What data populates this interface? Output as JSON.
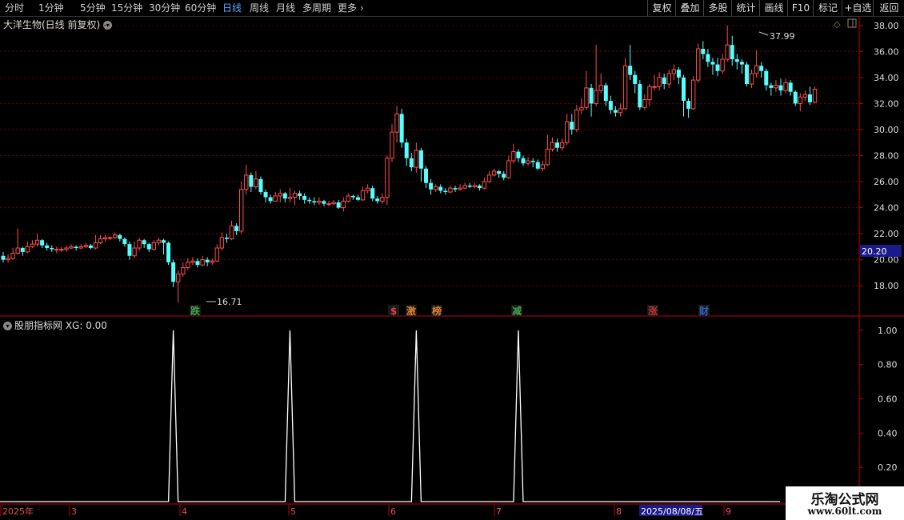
{
  "toolbar": {
    "periods": [
      "分时",
      "1分钟",
      "5分钟",
      "15分钟",
      "30分钟",
      "60分钟",
      "日线",
      "周线",
      "月线",
      "多周期",
      "更多"
    ],
    "active_period": "日线",
    "right_buttons": [
      "复权",
      "叠加",
      "多股",
      "统计",
      "画线",
      "F10",
      "标记",
      "+自选",
      "返回"
    ]
  },
  "main_title": "大洋生物(日线 前复权)",
  "indicator_title": "股朋指标网 XG: 0.00",
  "price_axis": {
    "ticks": [
      "38.00",
      "36.00",
      "34.00",
      "32.00",
      "30.00",
      "28.00",
      "26.00",
      "24.00",
      "22.00",
      "20.00",
      "18.00"
    ],
    "current_price": "20.20"
  },
  "indicator_axis": {
    "ticks": [
      "1.00",
      "0.80",
      "0.60",
      "0.40",
      "0.20"
    ]
  },
  "annotations": {
    "high": "37.99",
    "low": "16.71"
  },
  "event_markers": [
    {
      "label": "跌",
      "color": "#3fa34d"
    },
    {
      "label": "$",
      "color": "#e04040"
    },
    {
      "label": "激",
      "color": "#e08030"
    },
    {
      "label": "榜",
      "color": "#e08030"
    },
    {
      "label": "减",
      "color": "#3fa34d"
    },
    {
      "label": "涨",
      "color": "#c03030"
    },
    {
      "label": "财",
      "color": "#3060c0"
    }
  ],
  "time_axis": {
    "labels": [
      "2025年",
      "3",
      "4",
      "5",
      "6",
      "7",
      "8",
      "9"
    ],
    "cursor_date": "2025/08/08/五"
  },
  "watermark": {
    "line1": "乐淘公式网",
    "line2": "www.60lt.com"
  },
  "colors": {
    "up": "#ff4c4c",
    "down": "#54ffff",
    "grid": "#7a0000",
    "axis": "#c00000"
  },
  "chart_data": {
    "type": "candlestick",
    "ylim": [
      15.8,
      38.6
    ],
    "candles": [
      [
        20.3,
        20.0,
        20.6,
        19.8
      ],
      [
        20.0,
        20.1,
        20.4,
        19.8
      ],
      [
        20.1,
        20.5,
        20.9,
        20.0
      ],
      [
        20.5,
        20.9,
        22.4,
        20.4
      ],
      [
        20.9,
        20.6,
        21.0,
        20.3
      ],
      [
        20.6,
        21.0,
        21.4,
        20.5
      ],
      [
        21.0,
        21.2,
        21.5,
        20.9
      ],
      [
        21.2,
        21.5,
        22.0,
        21.0
      ],
      [
        21.5,
        21.1,
        21.6,
        20.9
      ],
      [
        21.1,
        20.9,
        21.3,
        20.7
      ],
      [
        20.9,
        20.8,
        21.1,
        20.6
      ],
      [
        20.8,
        20.8,
        21.0,
        20.5
      ],
      [
        20.8,
        20.8,
        21.0,
        20.6
      ],
      [
        20.8,
        20.9,
        21.1,
        20.6
      ],
      [
        20.9,
        21.0,
        21.2,
        20.8
      ],
      [
        21.0,
        20.9,
        21.1,
        20.7
      ],
      [
        20.9,
        21.0,
        21.2,
        20.8
      ],
      [
        21.0,
        21.1,
        21.3,
        20.9
      ],
      [
        21.1,
        20.9,
        21.2,
        20.8
      ],
      [
        20.9,
        21.3,
        21.9,
        20.8
      ],
      [
        21.3,
        21.6,
        21.9,
        21.2
      ],
      [
        21.6,
        21.7,
        21.9,
        21.4
      ],
      [
        21.7,
        21.7,
        21.8,
        21.5
      ],
      [
        21.7,
        21.9,
        22.1,
        21.6
      ],
      [
        21.9,
        21.6,
        22.0,
        21.4
      ],
      [
        21.6,
        21.2,
        21.7,
        21.0
      ],
      [
        21.2,
        20.3,
        21.4,
        20.0
      ],
      [
        20.3,
        20.9,
        21.4,
        20.1
      ],
      [
        20.9,
        21.5,
        21.7,
        20.7
      ],
      [
        21.5,
        21.2,
        21.6,
        20.9
      ],
      [
        21.2,
        20.8,
        21.3,
        20.6
      ],
      [
        20.8,
        21.3,
        21.5,
        20.7
      ],
      [
        21.3,
        21.5,
        21.7,
        21.1
      ],
      [
        21.5,
        21.3,
        21.6,
        20.4
      ],
      [
        21.3,
        19.8,
        21.4,
        19.6
      ],
      [
        19.8,
        18.3,
        20.0,
        17.9
      ],
      [
        18.3,
        18.9,
        19.2,
        16.7
      ],
      [
        18.9,
        19.4,
        19.8,
        18.7
      ],
      [
        19.4,
        19.8,
        20.1,
        19.2
      ],
      [
        19.8,
        19.9,
        20.2,
        19.6
      ],
      [
        19.9,
        19.6,
        20.1,
        19.4
      ],
      [
        19.6,
        20.0,
        20.3,
        19.5
      ],
      [
        20.0,
        19.8,
        20.2,
        19.5
      ],
      [
        19.8,
        19.9,
        20.1,
        19.6
      ],
      [
        19.9,
        20.9,
        21.2,
        19.8
      ],
      [
        20.9,
        21.7,
        22.1,
        20.7
      ],
      [
        21.7,
        21.6,
        22.0,
        21.3
      ],
      [
        21.6,
        22.6,
        23.0,
        21.5
      ],
      [
        22.6,
        22.2,
        22.8,
        21.9
      ],
      [
        22.2,
        25.4,
        26.0,
        22.0
      ],
      [
        25.4,
        26.5,
        27.3,
        25.0
      ],
      [
        26.5,
        25.6,
        26.7,
        25.2
      ],
      [
        25.6,
        26.2,
        26.8,
        25.4
      ],
      [
        26.2,
        25.2,
        26.4,
        25.0
      ],
      [
        25.2,
        24.8,
        25.4,
        24.4
      ],
      [
        24.8,
        24.5,
        25.0,
        24.3
      ],
      [
        24.5,
        24.9,
        25.2,
        24.6
      ],
      [
        24.9,
        25.1,
        25.4,
        24.4
      ],
      [
        25.1,
        24.7,
        25.2,
        24.4
      ],
      [
        24.7,
        24.8,
        25.5,
        24.4
      ],
      [
        24.8,
        25.1,
        25.3,
        24.2
      ],
      [
        25.1,
        24.9,
        25.3,
        24.6
      ],
      [
        24.9,
        24.6,
        25.1,
        24.3
      ],
      [
        24.6,
        24.5,
        24.8,
        24.3
      ],
      [
        24.5,
        24.4,
        24.8,
        24.2
      ],
      [
        24.4,
        24.5,
        24.8,
        24.2
      ],
      [
        24.5,
        24.3,
        24.6,
        24.1
      ],
      [
        24.3,
        24.3,
        24.5,
        24.1
      ],
      [
        24.3,
        24.4,
        24.6,
        24.2
      ],
      [
        24.4,
        24.0,
        24.6,
        23.9
      ],
      [
        24.0,
        24.5,
        24.8,
        23.7
      ],
      [
        24.5,
        24.9,
        25.1,
        24.4
      ],
      [
        24.9,
        24.8,
        25.0,
        24.6
      ],
      [
        24.8,
        24.6,
        25.0,
        24.5
      ],
      [
        24.6,
        25.3,
        25.6,
        24.5
      ],
      [
        25.3,
        25.5,
        25.8,
        25.1
      ],
      [
        25.5,
        24.7,
        25.7,
        24.5
      ],
      [
        24.7,
        24.5,
        24.9,
        24.3
      ],
      [
        24.5,
        24.8,
        25.1,
        24.3
      ],
      [
        24.8,
        27.8,
        28.0,
        24.2
      ],
      [
        27.8,
        29.8,
        30.4,
        27.5
      ],
      [
        29.8,
        31.2,
        31.8,
        29.0
      ],
      [
        31.2,
        29.0,
        31.6,
        28.6
      ],
      [
        29.0,
        27.8,
        29.3,
        27.2
      ],
      [
        27.8,
        27.1,
        28.2,
        26.8
      ],
      [
        27.1,
        28.4,
        29.0,
        26.7
      ],
      [
        28.4,
        27.0,
        28.6,
        26.0
      ],
      [
        27.0,
        25.9,
        27.2,
        25.5
      ],
      [
        25.9,
        25.4,
        26.2,
        25.0
      ],
      [
        25.4,
        25.6,
        25.8,
        25.2
      ],
      [
        25.6,
        25.3,
        25.8,
        25.1
      ],
      [
        25.3,
        25.2,
        25.5,
        25.0
      ],
      [
        25.2,
        25.5,
        25.7,
        25.1
      ],
      [
        25.5,
        25.4,
        25.7,
        25.2
      ],
      [
        25.4,
        25.5,
        25.8,
        25.3
      ],
      [
        25.5,
        25.7,
        25.9,
        25.4
      ],
      [
        25.7,
        25.6,
        25.9,
        25.5
      ],
      [
        25.6,
        25.7,
        25.9,
        25.5
      ],
      [
        25.7,
        25.5,
        25.8,
        25.3
      ],
      [
        25.5,
        26.0,
        26.3,
        25.4
      ],
      [
        26.0,
        26.5,
        26.8,
        25.9
      ],
      [
        26.5,
        26.8,
        27.0,
        26.4
      ],
      [
        26.8,
        26.6,
        26.9,
        26.3
      ],
      [
        26.6,
        26.3,
        26.8,
        26.1
      ],
      [
        26.3,
        27.6,
        28.0,
        26.2
      ],
      [
        27.6,
        28.3,
        28.9,
        27.4
      ],
      [
        28.3,
        27.8,
        28.5,
        27.5
      ],
      [
        27.8,
        27.4,
        28.0,
        27.2
      ],
      [
        27.4,
        27.6,
        27.9,
        27.2
      ],
      [
        27.6,
        27.5,
        27.8,
        27.1
      ],
      [
        27.5,
        27.0,
        27.7,
        26.9
      ],
      [
        27.0,
        27.3,
        27.6,
        26.8
      ],
      [
        27.3,
        28.5,
        29.6,
        27.2
      ],
      [
        28.5,
        29.0,
        29.4,
        28.3
      ],
      [
        29.0,
        28.6,
        29.3,
        28.3
      ],
      [
        28.6,
        29.0,
        29.3,
        28.4
      ],
      [
        29.0,
        30.6,
        31.2,
        28.8
      ],
      [
        30.6,
        30.0,
        31.2,
        29.6
      ],
      [
        30.0,
        31.5,
        31.9,
        29.8
      ],
      [
        31.5,
        31.7,
        32.4,
        31.2
      ],
      [
        31.7,
        33.2,
        34.5,
        31.5
      ],
      [
        33.2,
        32.0,
        33.5,
        31.0
      ],
      [
        32.0,
        33.0,
        36.5,
        31.8
      ],
      [
        33.0,
        33.4,
        34.3,
        32.8
      ],
      [
        33.4,
        32.2,
        33.6,
        31.8
      ],
      [
        32.2,
        31.5,
        32.6,
        31.2
      ],
      [
        31.5,
        31.3,
        31.8,
        31.0
      ],
      [
        31.3,
        31.6,
        32.0,
        31.0
      ],
      [
        31.6,
        34.9,
        35.5,
        31.5
      ],
      [
        34.9,
        34.2,
        36.5,
        33.8
      ],
      [
        34.2,
        33.5,
        34.5,
        32.8
      ],
      [
        33.5,
        31.7,
        33.8,
        31.5
      ],
      [
        31.7,
        32.3,
        32.7,
        31.5
      ],
      [
        32.3,
        33.3,
        33.5,
        31.8
      ],
      [
        33.3,
        33.3,
        34.2,
        33.0
      ],
      [
        33.3,
        34.0,
        34.4,
        33.0
      ],
      [
        34.0,
        33.5,
        34.3,
        33.1
      ],
      [
        33.5,
        34.3,
        34.6,
        33.2
      ],
      [
        34.3,
        34.6,
        35.0,
        33.8
      ],
      [
        34.6,
        34.0,
        34.8,
        33.5
      ],
      [
        34.0,
        32.2,
        34.2,
        31.0
      ],
      [
        32.2,
        31.6,
        32.4,
        30.9
      ],
      [
        31.6,
        33.8,
        34.1,
        31.5
      ],
      [
        33.8,
        36.2,
        36.6,
        33.6
      ],
      [
        36.2,
        35.8,
        36.8,
        35.4
      ],
      [
        35.8,
        35.2,
        36.2,
        34.8
      ],
      [
        35.2,
        35.0,
        35.5,
        34.2
      ],
      [
        35.0,
        34.5,
        35.5,
        34.1
      ],
      [
        34.5,
        35.4,
        35.8,
        34.3
      ],
      [
        35.4,
        36.5,
        38.0,
        35.2
      ],
      [
        36.5,
        35.4,
        37.2,
        34.9
      ],
      [
        35.4,
        35.2,
        35.8,
        34.6
      ],
      [
        35.2,
        35.0,
        35.4,
        34.3
      ],
      [
        35.0,
        33.5,
        35.2,
        33.3
      ],
      [
        33.5,
        34.3,
        34.6,
        33.2
      ],
      [
        34.3,
        34.9,
        36.1,
        34.0
      ],
      [
        34.9,
        34.5,
        35.2,
        34.0
      ],
      [
        34.5,
        33.4,
        34.7,
        33.0
      ],
      [
        33.4,
        33.2,
        33.6,
        32.6
      ],
      [
        33.2,
        33.4,
        33.8,
        32.9
      ],
      [
        33.4,
        33.0,
        33.9,
        32.6
      ],
      [
        33.0,
        33.6,
        33.9,
        32.8
      ],
      [
        33.6,
        32.9,
        33.8,
        32.6
      ],
      [
        32.9,
        32.0,
        33.0,
        31.8
      ],
      [
        32.0,
        32.5,
        32.8,
        31.4
      ],
      [
        32.5,
        32.7,
        33.0,
        32.2
      ],
      [
        32.7,
        32.1,
        33.3,
        31.9
      ],
      [
        32.1,
        33.1,
        33.3,
        32.0
      ]
    ],
    "indicator": {
      "name": "XG",
      "ylim": [
        0,
        1.06
      ],
      "spike_candle_indices": [
        35,
        59,
        85,
        106
      ]
    }
  }
}
